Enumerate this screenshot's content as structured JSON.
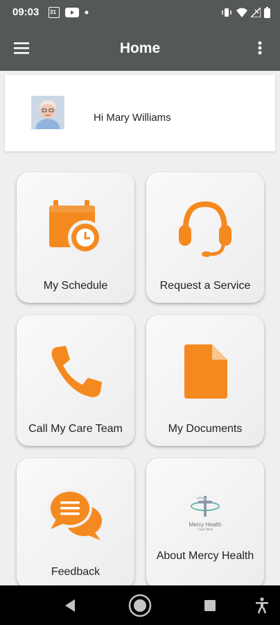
{
  "status_bar": {
    "time": "09:03",
    "calendar_badge": "31",
    "left_icons": [
      "calendar-icon",
      "youtube-icon",
      "dot-icon"
    ],
    "right_icons": [
      "vibrate-icon",
      "wifi-icon",
      "signal-icon",
      "battery-icon"
    ]
  },
  "app_bar": {
    "title": "Home",
    "menu_icon": "hamburger-menu-icon",
    "overflow_icon": "more-vert-icon"
  },
  "profile": {
    "greeting": "Hi Mary Williams",
    "avatar_icon": "user-photo"
  },
  "tiles": [
    {
      "label": "My Schedule",
      "icon": "calendar-clock-icon"
    },
    {
      "label": "Request a Service",
      "icon": "headset-icon"
    },
    {
      "label": "Call My Care Team",
      "icon": "phone-icon"
    },
    {
      "label": "My Documents",
      "icon": "document-icon"
    },
    {
      "label": "Feedback",
      "icon": "chat-bubbles-icon"
    },
    {
      "label": "About Mercy Health",
      "icon": "mercy-health-logo",
      "logo_text": "Mercy Health",
      "logo_subtext": "Care Bird"
    }
  ],
  "nav_bar": {
    "icons": [
      "back-icon",
      "home-icon",
      "recents-icon",
      "accessibility-icon"
    ]
  },
  "colors": {
    "accent": "#F48A1F",
    "bar": "#545856",
    "background": "#EFEFEF"
  }
}
